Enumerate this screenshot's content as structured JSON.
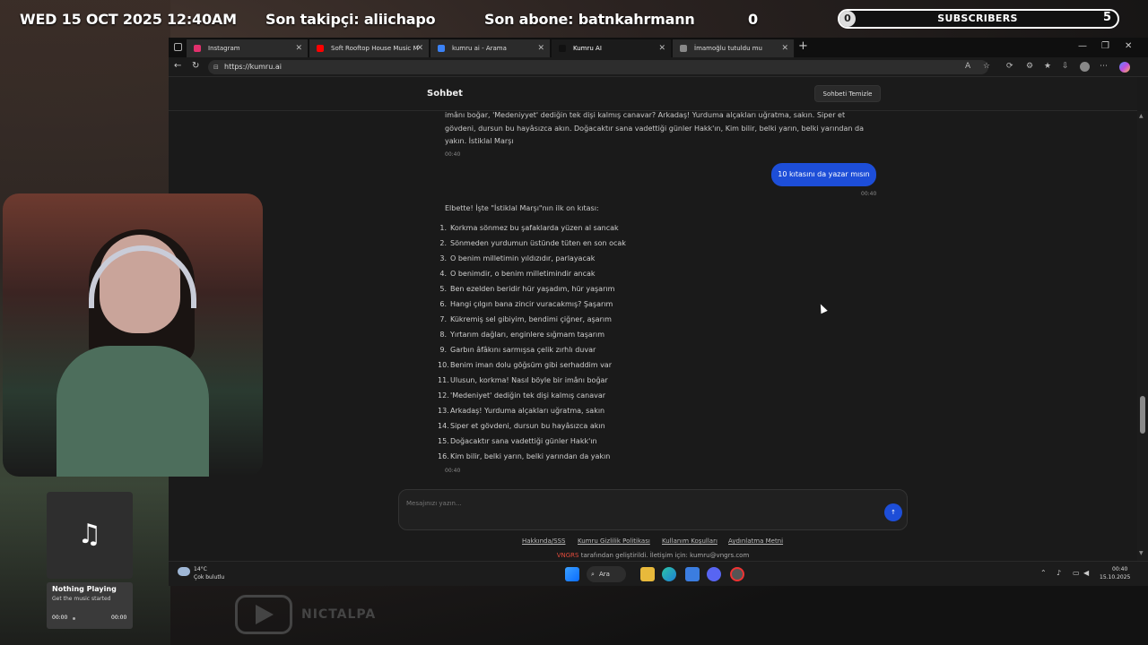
{
  "overlay": {
    "datetime": "WED 15 OCT 2025 12:40AM",
    "last_follower": "Son takipçi: aliichapo",
    "last_subscriber": "Son abone: batnkahrmann",
    "counter": "0",
    "subscribers_label": "SUBSCRIBERS",
    "subscribers_current": "0",
    "subscribers_goal": "5"
  },
  "browser": {
    "tabs": [
      {
        "label": "Instagram",
        "icon_color": "#e1306c",
        "close": "✕"
      },
      {
        "label": "Soft Rooftop House Music M",
        "icon_color": "#ff0000",
        "close": "✕"
      },
      {
        "label": "kumru ai - Arama",
        "icon_color": "#3b82f6",
        "close": "✕"
      },
      {
        "label": "Kumru AI",
        "icon_color": "#111111",
        "close": "✕"
      },
      {
        "label": "İmamoğlu tutuldu mu",
        "icon_color": "#888888",
        "close": "✕"
      }
    ],
    "new_tab": "+",
    "url": "https://kumru.ai",
    "window_controls": [
      "—",
      "❐",
      "✕"
    ]
  },
  "chat": {
    "header_title": "Sohbet",
    "clear_button": "Sohbeti Temizle",
    "prev_message": "imânı boğar, 'Medeniyyet' dediğin tek dişi kalmış canavar? Arkadaş! Yurduma alçakları uğratma, sakın. Siper et gövdeni, dursun bu hayâsızca akın. Doğacaktır sana vadettiği günler Hakk'ın, Kim bilir, belki yarın, belki yarından da yakın. İstiklal Marşı",
    "prev_time": "00:40",
    "user_message": "10 kıtasını da yazar mısın",
    "user_time": "00:40",
    "reply_intro": "Elbette! İşte \"İstiklal Marşı\"nın ilk on kıtası:",
    "reply_lines": [
      {
        "n": "1.",
        "t": "Korkma sönmez bu şafaklarda yüzen al sancak"
      },
      {
        "n": "2.",
        "t": "Sönmeden yurdumun üstünde tüten en son ocak"
      },
      {
        "n": "3.",
        "t": "O benim milletimin yıldızıdır, parlayacak"
      },
      {
        "n": "4.",
        "t": "O benimdir, o benim milletimindir ancak"
      },
      {
        "n": "5.",
        "t": "Ben ezelden beridir hür yaşadım, hür yaşarım"
      },
      {
        "n": "6.",
        "t": "Hangi çılgın bana zincir vuracakmış? Şaşarım"
      },
      {
        "n": "7.",
        "t": "Kükremiş sel gibiyim, bendimi çiğner, aşarım"
      },
      {
        "n": "8.",
        "t": "Yırtarım dağları, enginlere sığmam taşarım"
      },
      {
        "n": "9.",
        "t": "Garbın âfâkını sarmışsa çelik zırhlı duvar"
      },
      {
        "n": "10.",
        "t": "Benim iman dolu göğsüm gibi serhaddim var"
      },
      {
        "n": "11.",
        "t": "Ulusun, korkma! Nasıl böyle bir imânı boğar"
      },
      {
        "n": "12.",
        "t": "'Medeniyet' dediğin tek dişi kalmış canavar"
      },
      {
        "n": "13.",
        "t": "Arkadaş! Yurduma alçakları uğratma, sakın"
      },
      {
        "n": "14.",
        "t": "Siper et gövdeni, dursun bu hayâsızca akın"
      },
      {
        "n": "15.",
        "t": "Doğacaktır sana vadettiği günler Hakk'ın"
      },
      {
        "n": "16.",
        "t": "Kim bilir, belki yarın, belki yarından da yakın"
      }
    ],
    "reply_time": "00:40",
    "input_placeholder": "Mesajınızı yazın...",
    "send_label": "↑",
    "footer_links": [
      "Hakkında/SSS",
      "Kumru Gizlilik Politikası",
      "Kullanım Koşulları",
      "Aydınlatma Metni"
    ],
    "footer_brand": "VNGRS",
    "footer_credit": "tarafından geliştirildi. İletişim için: kumru@vngrs.com"
  },
  "taskbar": {
    "weather_temp": "14°C",
    "weather_desc": "Çok bulutlu",
    "search_label": "Ara",
    "time": "00:40",
    "date": "15.10.2025"
  },
  "music": {
    "title": "Nothing Playing",
    "subtitle": "Get the music started",
    "time_start": "00:00",
    "time_end": "00:00",
    "icon": "music-note-icon"
  },
  "channel": {
    "name": "NICTALPA"
  }
}
